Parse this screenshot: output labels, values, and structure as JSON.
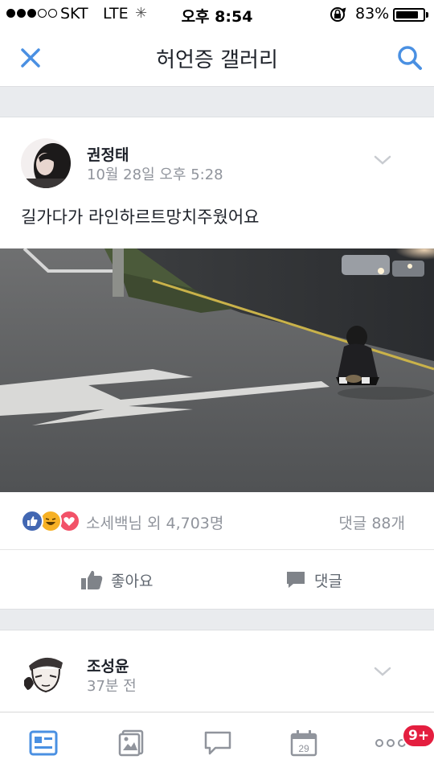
{
  "status_bar": {
    "carrier": "SKT",
    "network": "LTE",
    "loading_indicator": "✳",
    "time": "오후 8:54",
    "battery_percent": "83%",
    "battery_level": 0.83
  },
  "header": {
    "title": "허언증 갤러리",
    "close_icon": "close-icon",
    "search_icon": "search-icon"
  },
  "posts": [
    {
      "author": "권정태",
      "time": "10월 28일 오후 5:28",
      "text": "길가다가 라인하르트망치주웠어요",
      "reactions": {
        "icons": [
          "like",
          "haha",
          "love"
        ],
        "summary": "소세백님 외 4,703명",
        "comments": "댓글 88개"
      },
      "actions": {
        "like": "좋아요",
        "comment": "댓글"
      }
    },
    {
      "author": "조성윤",
      "time": "37분 전"
    }
  ],
  "tab_bar": {
    "tabs": [
      "newsfeed-icon",
      "photos-icon",
      "messages-icon",
      "calendar-icon",
      "more-icon"
    ],
    "calendar_day": "29",
    "badge": "9+"
  },
  "colors": {
    "accent": "#4a90e2",
    "like_blue": "#4267b2",
    "love_red": "#f25268",
    "haha_yellow": "#f7b125",
    "badge_red": "#e41e3f",
    "muted_text": "#90949c"
  }
}
